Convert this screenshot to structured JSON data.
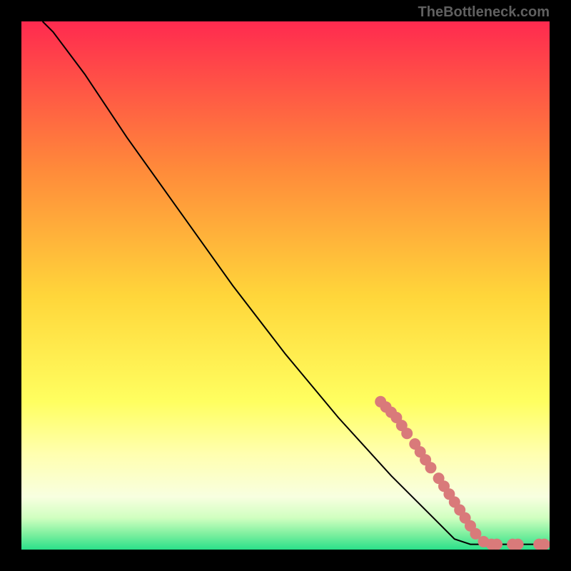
{
  "source_label": "TheBottleneck.com",
  "chart_data": {
    "type": "line",
    "title": "",
    "xlabel": "",
    "ylabel": "",
    "xlim": [
      0,
      100
    ],
    "ylim": [
      0,
      100
    ],
    "gradient_colors": {
      "top": "#ff2a4f",
      "mid_upper": "#ff8a3a",
      "mid": "#ffd63a",
      "mid_lower": "#ffff60",
      "lower": "#f0ffd0",
      "bottom": "#2ae08a"
    },
    "curve": [
      {
        "x": 4,
        "y": 100
      },
      {
        "x": 6,
        "y": 98
      },
      {
        "x": 9,
        "y": 94
      },
      {
        "x": 12,
        "y": 90
      },
      {
        "x": 20,
        "y": 78
      },
      {
        "x": 30,
        "y": 64
      },
      {
        "x": 40,
        "y": 50
      },
      {
        "x": 50,
        "y": 37
      },
      {
        "x": 60,
        "y": 25
      },
      {
        "x": 70,
        "y": 14
      },
      {
        "x": 78,
        "y": 6
      },
      {
        "x": 82,
        "y": 2
      },
      {
        "x": 85,
        "y": 1
      },
      {
        "x": 90,
        "y": 1
      },
      {
        "x": 95,
        "y": 1
      },
      {
        "x": 100,
        "y": 1
      }
    ],
    "dots": [
      {
        "x": 68,
        "y": 28
      },
      {
        "x": 69,
        "y": 27
      },
      {
        "x": 70,
        "y": 26
      },
      {
        "x": 71,
        "y": 25
      },
      {
        "x": 72,
        "y": 23.5
      },
      {
        "x": 73,
        "y": 22
      },
      {
        "x": 74.5,
        "y": 20
      },
      {
        "x": 75.5,
        "y": 18.5
      },
      {
        "x": 76.5,
        "y": 17
      },
      {
        "x": 77.5,
        "y": 15.5
      },
      {
        "x": 79,
        "y": 13.5
      },
      {
        "x": 80,
        "y": 12
      },
      {
        "x": 81,
        "y": 10.5
      },
      {
        "x": 82,
        "y": 9
      },
      {
        "x": 83,
        "y": 7.5
      },
      {
        "x": 84,
        "y": 6
      },
      {
        "x": 85,
        "y": 4.5
      },
      {
        "x": 86,
        "y": 3
      },
      {
        "x": 87.5,
        "y": 1.5
      },
      {
        "x": 89,
        "y": 1
      },
      {
        "x": 90,
        "y": 1
      },
      {
        "x": 93,
        "y": 1
      },
      {
        "x": 94,
        "y": 1
      },
      {
        "x": 98,
        "y": 1
      },
      {
        "x": 99,
        "y": 1
      }
    ],
    "dot_color": "#d97a7a",
    "curve_color": "#000000"
  }
}
